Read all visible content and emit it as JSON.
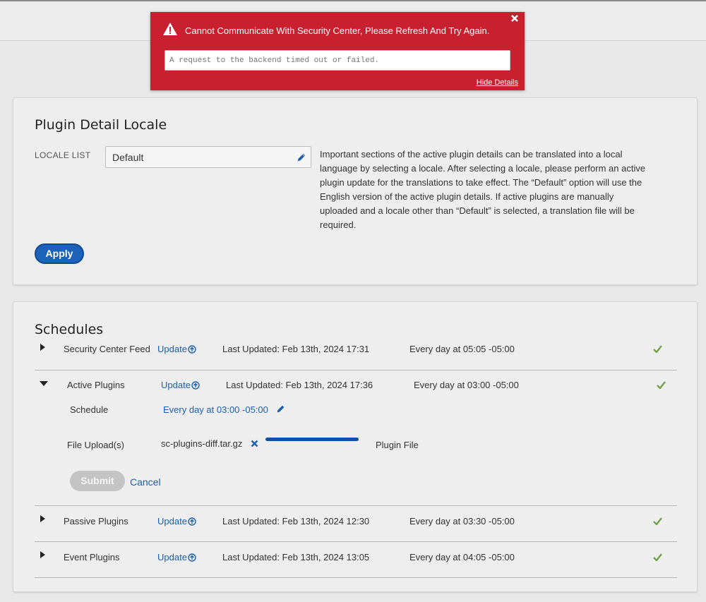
{
  "alert": {
    "title": "Cannot Communicate With Security Center, Please Refresh And Try Again.",
    "detail_text": "A request to the backend timed out or failed.",
    "hide_details_label": "Hide Details",
    "color": "#c8202e"
  },
  "locale_panel": {
    "title": "Plugin Detail Locale",
    "locale_label": "LOCALE LIST",
    "locale_value": "Default",
    "description": "Important sections of the active plugin details can be translated into a local language by selecting a locale. After selecting a locale, please perform an active plugin update for the translations to take effect. The “Default” option will use the English version of the active plugin details. If active plugins are manually uploaded and a locale other than “Default” is selected, a translation file will be required.",
    "apply_label": "Apply"
  },
  "schedules": {
    "title": "Schedules",
    "update_label": "Update",
    "rows": [
      {
        "name": "Security Center Feed",
        "last_updated": "Last Updated: Feb 13th, 2024 17:31",
        "frequency": "Every day at 05:05 -05:00"
      },
      {
        "name": "Active Plugins",
        "last_updated": "Last Updated: Feb 13th, 2024 17:36",
        "frequency": "Every day at 03:00 -05:00"
      },
      {
        "name": "Passive Plugins",
        "last_updated": "Last Updated: Feb 13th, 2024 12:30",
        "frequency": "Every day at 03:30 -05:00"
      },
      {
        "name": "Event Plugins",
        "last_updated": "Last Updated: Feb 13th, 2024 13:05",
        "frequency": "Every day at 04:05 -05:00"
      }
    ],
    "expanded": {
      "schedule_label": "Schedule",
      "schedule_value": "Every day at 03:00 -05:00",
      "file_upload_label": "File Upload(s)",
      "file_name": "sc-plugins-diff.tar.gz",
      "upload_progress": 1.0,
      "file_type_label": "Plugin File",
      "submit_label": "Submit",
      "cancel_label": "Cancel"
    }
  },
  "colors": {
    "link": "#1c5fb0",
    "primary_button": "#1c62b9",
    "check": "#6fa14a"
  }
}
